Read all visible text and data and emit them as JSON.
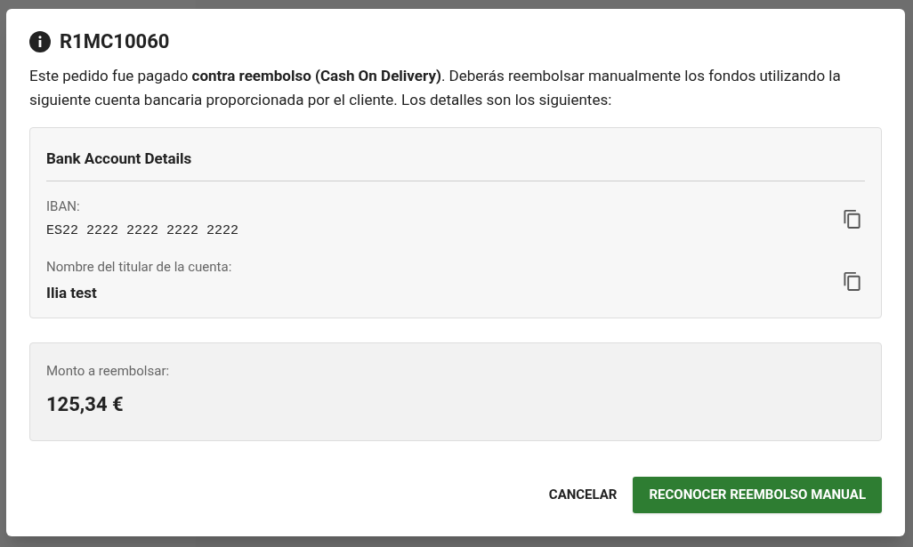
{
  "dialog": {
    "title": "R1MC10060",
    "message": "Este pedido fue pagado **contra reembolso (Cash On Delivery)**. Deberás reembolsar manualmente los fondos utilizando la siguiente cuenta bancaria proporcionada por el cliente. Los detalles son los siguientes:",
    "bank_card": {
      "heading": "Bank Account Details",
      "fields": [
        {
          "label": "IBAN:",
          "value": "ES22 2222 2222 2222 2222",
          "kind": "mono"
        },
        {
          "label": "Nombre del titular de la cuenta:",
          "value": "Ilia test",
          "kind": "bold"
        }
      ]
    },
    "amount_card": {
      "label": "Monto a reembolsar:",
      "value": "125,34 €"
    },
    "buttons": [
      {
        "label": "CANCELAR",
        "kind": "text"
      },
      {
        "label": "RECONOCER REEMBOLSO MANUAL",
        "kind": "primary"
      }
    ]
  }
}
